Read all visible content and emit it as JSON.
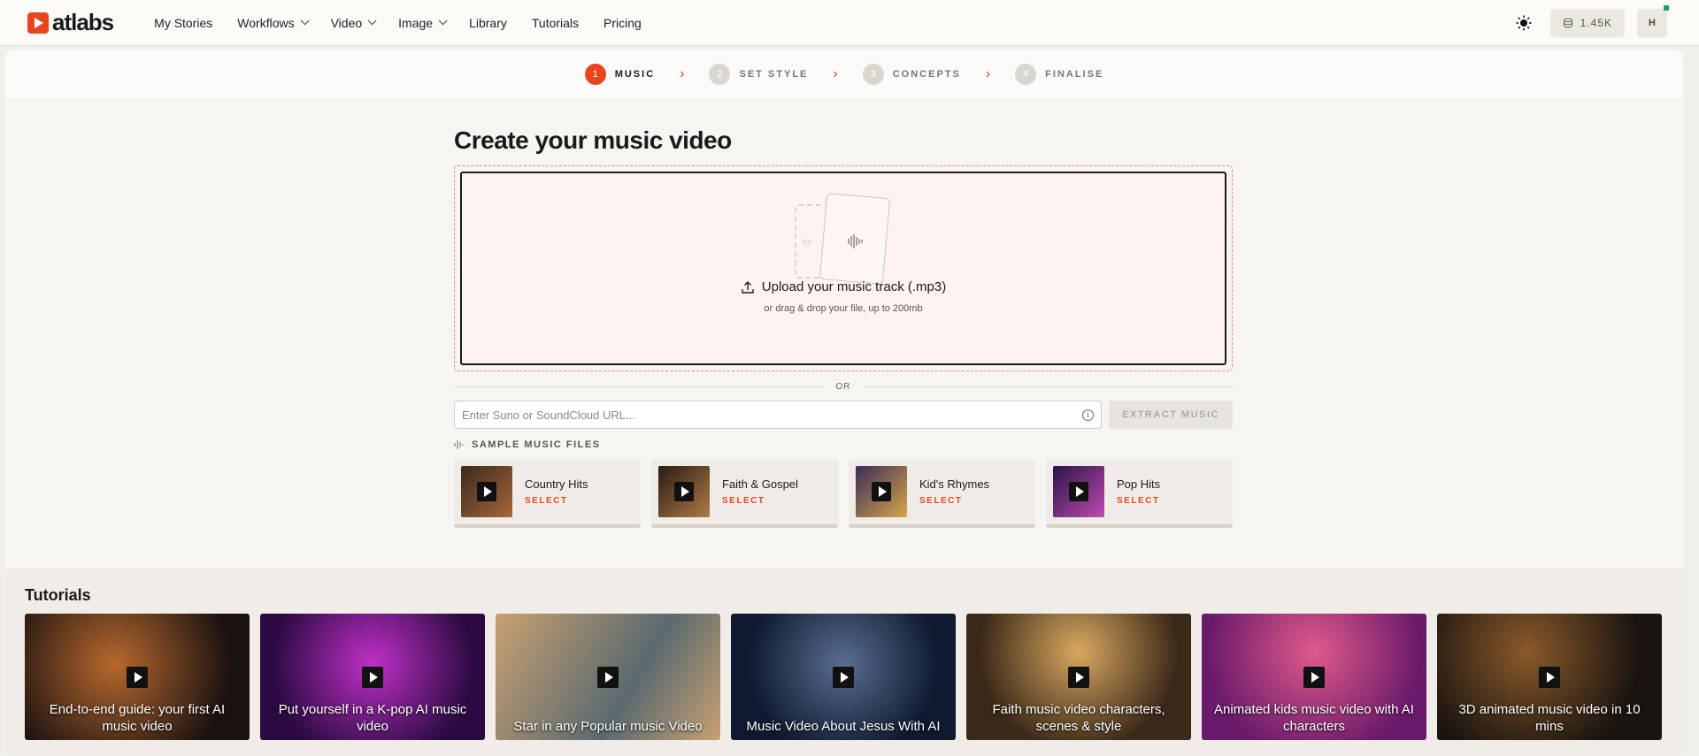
{
  "brand": {
    "name": "atlabs"
  },
  "nav": {
    "items": [
      {
        "label": "My Stories",
        "dropdown": false
      },
      {
        "label": "Workflows",
        "dropdown": true
      },
      {
        "label": "Video",
        "dropdown": true
      },
      {
        "label": "Image",
        "dropdown": true
      },
      {
        "label": "Library",
        "dropdown": false
      },
      {
        "label": "Tutorials",
        "dropdown": false
      },
      {
        "label": "Pricing",
        "dropdown": false
      }
    ],
    "credits": "1.45K",
    "avatar_initial": "H"
  },
  "stepper": {
    "steps": [
      {
        "num": "1",
        "label": "MUSIC",
        "active": true
      },
      {
        "num": "2",
        "label": "SET STYLE",
        "active": false
      },
      {
        "num": "3",
        "label": "CONCEPTS",
        "active": false
      },
      {
        "num": "4",
        "label": "FINALISE",
        "active": false
      }
    ]
  },
  "main": {
    "title": "Create your music video",
    "upload_label": "Upload your music track (.mp3)",
    "upload_sub": "or drag & drop your file, up to 200mb",
    "or_text": "OR",
    "url_placeholder": "Enter Suno or SoundCloud URL...",
    "extract_label": "EXTRACT MUSIC",
    "samples_heading": "SAMPLE MUSIC FILES",
    "select_label": "SELECT",
    "samples": [
      {
        "name": "Country Hits",
        "colors": [
          "#3a2a1e",
          "#a8653a"
        ]
      },
      {
        "name": "Faith & Gospel",
        "colors": [
          "#2a1c14",
          "#b07a46"
        ]
      },
      {
        "name": "Kid's Rhymes",
        "colors": [
          "#3a2c5a",
          "#d8a64a"
        ]
      },
      {
        "name": "Pop Hits",
        "colors": [
          "#2a1446",
          "#c04ab0"
        ]
      }
    ]
  },
  "tutorials": {
    "title": "Tutorials",
    "items": [
      {
        "caption": "End-to-end guide: your first AI music video",
        "colors": [
          "#1a1210",
          "#b8682e"
        ]
      },
      {
        "caption": "Put yourself in a K-pop AI music video",
        "colors": [
          "#2a0a40",
          "#c030c8"
        ]
      },
      {
        "caption": "Star in any Popular music Video",
        "colors": [
          "#5a6a70",
          "#c8a070"
        ]
      },
      {
        "caption": "Music Video About Jesus With AI",
        "colors": [
          "#0e1a30",
          "#5a6e90"
        ]
      },
      {
        "caption": "Faith music video characters, scenes & style",
        "colors": [
          "#3a2818",
          "#d8a860"
        ]
      },
      {
        "caption": "Animated kids music video with AI characters",
        "colors": [
          "#6a1a6a",
          "#e05a8a"
        ]
      },
      {
        "caption": "3D animated music video in 10 mins",
        "colors": [
          "#1a1410",
          "#8a5a2a"
        ]
      }
    ]
  }
}
